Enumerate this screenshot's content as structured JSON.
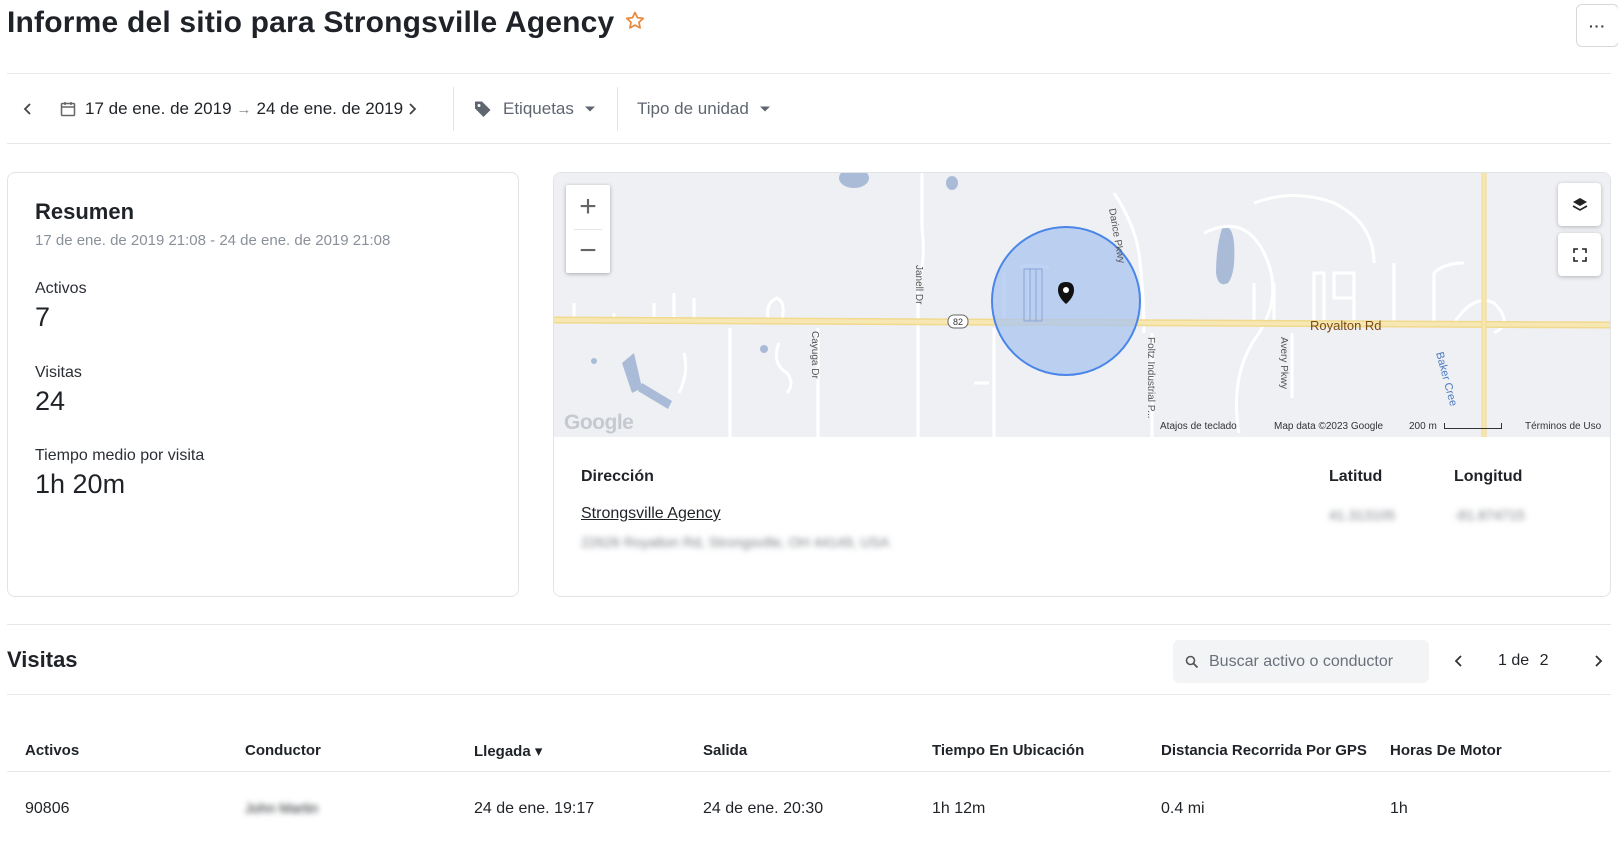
{
  "page": {
    "title": "Informe del sitio para Strongsville Agency",
    "more_label": "···"
  },
  "filters": {
    "date_start": "17 de ene. de 2019",
    "date_end": "24 de ene. de 2019",
    "arrow": "→",
    "tags_label": "Etiquetas",
    "unit_type_label": "Tipo de unidad"
  },
  "summary": {
    "title": "Resumen",
    "range": "17 de ene. de 2019 21:08 - 24 de ene. de 2019 21:08",
    "metrics": [
      {
        "label": "Activos",
        "value": "7"
      },
      {
        "label": "Visitas",
        "value": "24"
      },
      {
        "label": "Tiempo medio por visita",
        "value": "1h 20m"
      }
    ]
  },
  "map": {
    "road_label": "Royalton Rd",
    "route_badge": "82",
    "street_labels": [
      "Janell Dr",
      "Cayuga Dr",
      "Darice Pkwy",
      "Foltz Industrial P...",
      "Avery Pkwy",
      "Baker Cree"
    ],
    "footer": {
      "shortcuts": "Atajos de teclado",
      "map_data": "Map data ©2023 Google",
      "scale": "200 m",
      "terms": "Términos de Uso"
    },
    "logo": "Google",
    "zoom_in": "+",
    "zoom_out": "−"
  },
  "address": {
    "heading": "Dirección",
    "lat_heading": "Latitud",
    "lng_heading": "Longitud",
    "name": "Strongsville Agency",
    "street": "22626 Royalton Rd, Strongsville, OH 44149, USA",
    "lat": "41.313105",
    "lng": "-81.874715"
  },
  "visits": {
    "title": "Visitas",
    "search_placeholder": "Buscar activo o conductor",
    "page_current": "1",
    "page_of": "de",
    "page_total": "2",
    "columns": [
      "Activos",
      "Conductor",
      "Llegada ▾",
      "Salida",
      "Tiempo En Ubicación",
      "Distancia Recorrida Por GPS",
      "Horas De Motor"
    ],
    "rows": [
      {
        "asset": "90806",
        "driver": "John Martin",
        "arrival": "24 de ene. 19:17",
        "departure": "24 de ene. 20:30",
        "time_on_site": "1h 12m",
        "gps_distance": "0.4 mi",
        "engine_hours": "1h"
      }
    ]
  },
  "colors": {
    "accent_star": "#e8883a",
    "geofence_fill": "#aac4f0",
    "geofence_stroke": "#4a86e8",
    "road": "#f5e3a8"
  }
}
